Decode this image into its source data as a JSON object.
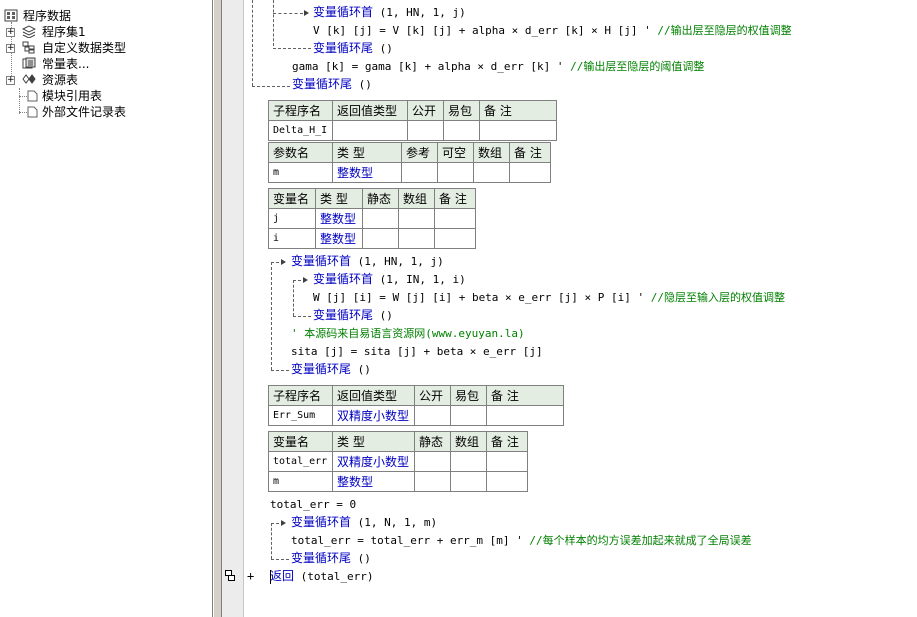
{
  "tree": {
    "root": "程序数据",
    "items": [
      "程序集1",
      "自定义数据类型",
      "常量表...",
      "资源表",
      "模块引用表",
      "外部文件记录表"
    ]
  },
  "code": {
    "l1_kw": "变量循环首",
    "l1_args": " (1, HN, 1, j)",
    "l2_code": "V [k] [j] = V [k] [j] + alpha × d_err [k] × H [j]  ' ",
    "l2_comment": "//输出层至隐层的权值调整",
    "l3_kw": "变量循环尾",
    "l3_args": " ()",
    "l4_code": "gama [k] = gama [k] + alpha × d_err [k]  ' ",
    "l4_comment": "//输出层至隐层的阈值调整",
    "l5_kw": "变量循环尾",
    "l5_args": " ()",
    "sub1": {
      "headers": [
        "子程序名",
        "返回值类型",
        "公开",
        "易包",
        "备 注"
      ],
      "name": "Delta_H_I",
      "param_headers": [
        "参数名",
        "类 型",
        "参考",
        "可空",
        "数组",
        "备 注"
      ],
      "params": [
        {
          "name": "m",
          "type": "整数型"
        }
      ]
    },
    "vars1": {
      "headers": [
        "变量名",
        "类 型",
        "静态",
        "数组",
        "备 注"
      ],
      "rows": [
        {
          "name": "j",
          "type": "整数型"
        },
        {
          "name": "i",
          "type": "整数型"
        }
      ]
    },
    "l6_kw": "变量循环首",
    "l6_args": " (1, HN, 1, j)",
    "l7_kw": "变量循环首",
    "l7_args": " (1, IN, 1, i)",
    "l8_code": "W [j] [i] = W [j] [i] + beta × e_err [j] × P [i]  ' ",
    "l8_comment": "//隐层至输入层的权值调整",
    "l9_kw": "变量循环尾",
    "l9_args": " ()",
    "l10_comment": "' 本源码来自易语言资源网(www.eyuyan.la)",
    "l11_code": "sita [j] = sita [j] + beta × e_err [j]",
    "l12_kw": "变量循环尾",
    "l12_args": " ()",
    "sub2": {
      "headers": [
        "子程序名",
        "返回值类型",
        "公开",
        "易包",
        "备 注"
      ],
      "name": "Err_Sum",
      "ret": "双精度小数型"
    },
    "vars2": {
      "headers": [
        "变量名",
        "类 型",
        "静态",
        "数组",
        "备 注"
      ],
      "rows": [
        {
          "name": "total_err",
          "type": "双精度小数型"
        },
        {
          "name": "m",
          "type": "整数型"
        }
      ]
    },
    "l13_code": "total_err = 0",
    "l14_kw": "变量循环首",
    "l14_args": " (1, N, 1, m)",
    "l15_code": "total_err = total_err + err_m [m]  ' ",
    "l15_comment": "//每个样本的均方误差加起来就成了全局误差",
    "l16_kw": "变量循环尾",
    "l16_args": " ()",
    "l17_kw": "返回",
    "l17_args": " (total_err)"
  }
}
